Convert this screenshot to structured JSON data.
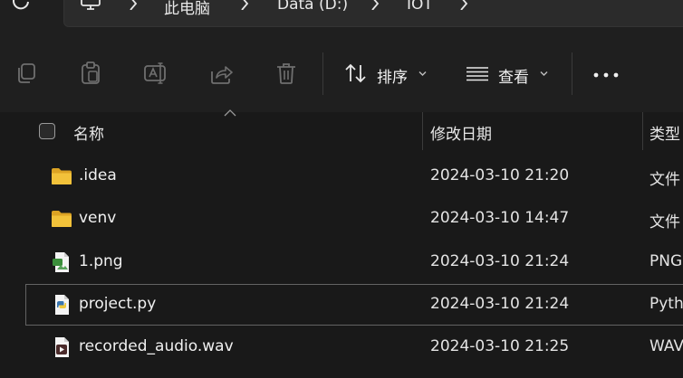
{
  "colors": {
    "background": "#191919",
    "chrome": "#1f1f1f",
    "folder": "#e8b528",
    "text": "#ffffff"
  },
  "breadcrumb": {
    "root_icon": "monitor-icon",
    "items": [
      "此电脑",
      "Data (D:)",
      "IOT"
    ]
  },
  "toolbar": {
    "icons": [
      "copy-icon",
      "paste-icon",
      "rename-icon",
      "share-icon",
      "delete-icon"
    ],
    "sort_label": "排序",
    "view_label": "查看",
    "more_icon": "more-dots-icon"
  },
  "columns": {
    "name": "名称",
    "modified": "修改日期",
    "type": "类型"
  },
  "files": [
    {
      "name": ".idea",
      "modified": "2024-03-10 21:20",
      "type": "文件",
      "icon": "folder-icon",
      "selected": false
    },
    {
      "name": "venv",
      "modified": "2024-03-10 14:47",
      "type": "文件",
      "icon": "folder-icon",
      "selected": false
    },
    {
      "name": "1.png",
      "modified": "2024-03-10 21:24",
      "type": "PNG",
      "icon": "png-file-icon",
      "selected": false
    },
    {
      "name": "project.py",
      "modified": "2024-03-10 21:24",
      "type": "Pyth",
      "icon": "python-file-icon",
      "selected": true
    },
    {
      "name": "recorded_audio.wav",
      "modified": "2024-03-10 21:25",
      "type": "WAV",
      "icon": "audio-file-icon",
      "selected": false
    }
  ]
}
